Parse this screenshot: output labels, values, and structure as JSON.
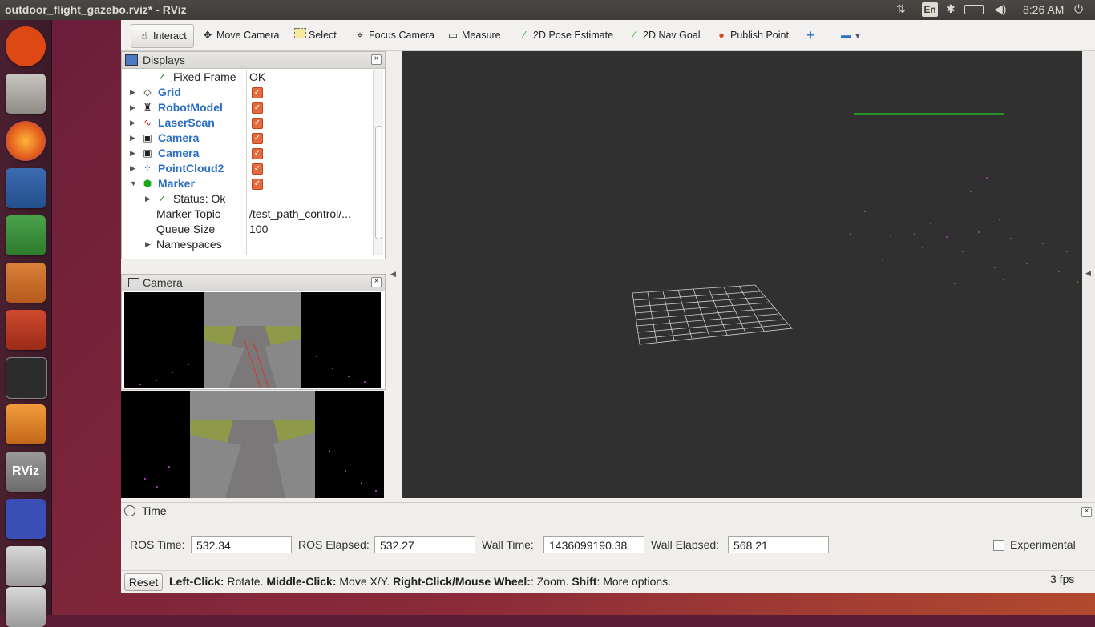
{
  "window_title": "outdoor_flight_gazebo.rviz* - RViz",
  "tray": {
    "keyboard": "En",
    "time": "8:26 AM"
  },
  "toolbar": {
    "interact": "Interact",
    "move_camera": "Move Camera",
    "select": "Select",
    "focus_camera": "Focus Camera",
    "measure": "Measure",
    "pose_estimate": "2D Pose Estimate",
    "nav_goal": "2D Nav Goal",
    "publish_point": "Publish Point"
  },
  "displays": {
    "title": "Displays",
    "fixed_frame": {
      "label": "Fixed Frame",
      "value": "OK"
    },
    "items": [
      "Grid",
      "RobotModel",
      "LaserScan",
      "Camera",
      "Camera",
      "PointCloud2",
      "Marker"
    ],
    "status": "Status: Ok",
    "marker_topic": {
      "label": "Marker Topic",
      "value": "/test_path_control/..."
    },
    "queue_size": {
      "label": "Queue Size",
      "value": "100"
    },
    "namespaces": "Namespaces"
  },
  "camera_panel": {
    "title": "Camera"
  },
  "time_panel": {
    "title": "Time",
    "ros_time_label": "ROS Time:",
    "ros_time": "532.34",
    "ros_elapsed_label": "ROS Elapsed:",
    "ros_elapsed": "532.27",
    "wall_time_label": "Wall Time:",
    "wall_time": "1436099190.38",
    "wall_elapsed_label": "Wall Elapsed:",
    "wall_elapsed": "568.21",
    "experimental": "Experimental"
  },
  "statusbar": {
    "reset": "Reset",
    "left_click": "Left-Click:",
    "left_click_action": "Rotate.",
    "middle_click": "Middle-Click:",
    "middle_click_action": "Move X/Y.",
    "right_click": "Right-Click/Mouse Wheel:",
    "right_click_action": ": Zoom.",
    "shift": "Shift",
    "shift_action": ": More options.",
    "fps": "3 fps"
  },
  "colors": {
    "accent_blue": "#2b6fc4",
    "checkbox": "#e56a3e",
    "view_bg": "#303030"
  }
}
